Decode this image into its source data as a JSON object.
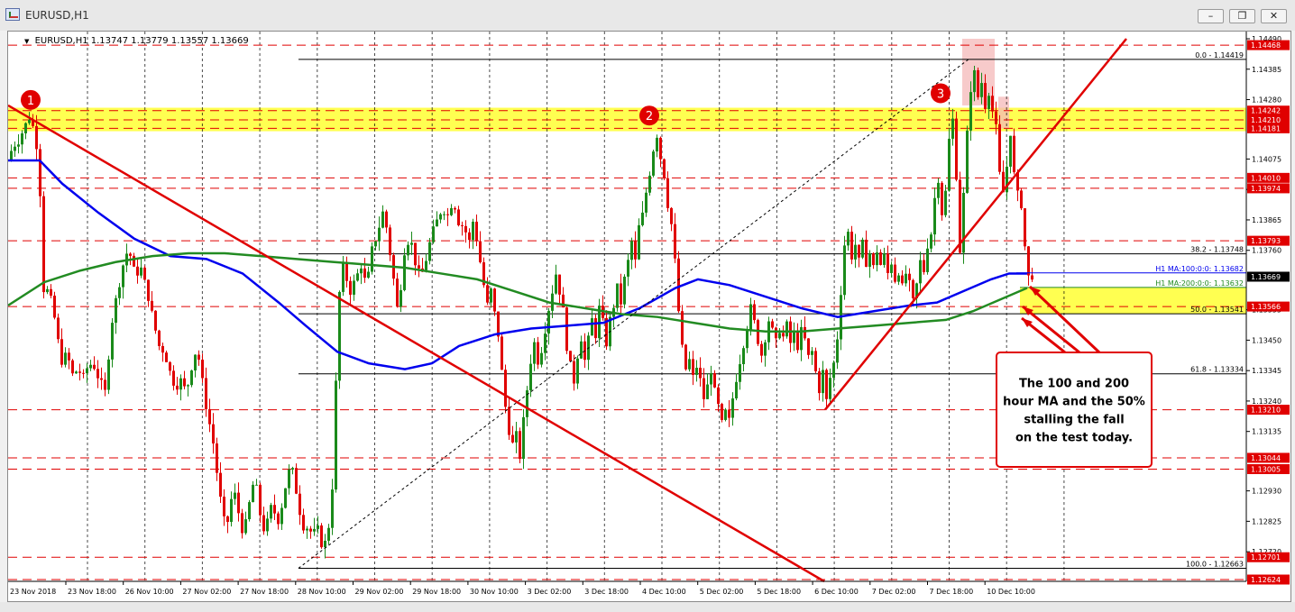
{
  "window": {
    "title": "EURUSD,H1",
    "min_glyph": "–",
    "max_glyph": "❐",
    "close_glyph": "✕"
  },
  "chart_info": {
    "arrow": "▼",
    "header": "EURUSD,H1  1.13747 1.13779 1.13557 1.13669"
  },
  "chart_data": {
    "type": "candlestick",
    "symbol": "EURUSD",
    "timeframe": "H1",
    "last_bar": {
      "open": 1.13747,
      "high": 1.13779,
      "low": 1.13557,
      "close": 1.13669
    },
    "y_range": [
      1.12624,
      1.1449
    ],
    "y_ticks": [
      1.1449,
      1.14385,
      1.1428,
      1.14075,
      1.1397,
      1.13865,
      1.1376,
      1.13555,
      1.1345,
      1.13345,
      1.1324,
      1.13135,
      1.1293,
      1.12825,
      1.1272
    ],
    "x_labels": [
      "23 Nov 2018",
      "23 Nov 18:00",
      "26 Nov 10:00",
      "27 Nov 02:00",
      "27 Nov 18:00",
      "28 Nov 10:00",
      "29 Nov 02:00",
      "29 Nov 18:00",
      "30 Nov 10:00",
      "3 Dec 02:00",
      "3 Dec 18:00",
      "4 Dec 10:00",
      "5 Dec 02:00",
      "5 Dec 18:00",
      "6 Dec 10:00",
      "7 Dec 02:00",
      "7 Dec 18:00",
      "10 Dec 10:00"
    ],
    "price_path": [
      [
        0,
        1.1407
      ],
      [
        6,
        1.1412
      ],
      [
        12,
        1.1414
      ],
      [
        18,
        1.1418
      ],
      [
        24,
        1.1422
      ],
      [
        30,
        1.1417
      ],
      [
        34,
        1.1408
      ],
      [
        38,
        1.1384
      ],
      [
        41,
        1.1352
      ],
      [
        44,
        1.1362
      ],
      [
        50,
        1.1357
      ],
      [
        55,
        1.1346
      ],
      [
        60,
        1.1338
      ],
      [
        66,
        1.134
      ],
      [
        72,
        1.1333
      ],
      [
        78,
        1.1335
      ],
      [
        84,
        1.1332
      ],
      [
        90,
        1.1337
      ],
      [
        96,
        1.1336
      ],
      [
        102,
        1.1331
      ],
      [
        108,
        1.1327
      ],
      [
        112,
        1.134
      ],
      [
        116,
        1.1352
      ],
      [
        122,
        1.1362
      ],
      [
        128,
        1.1371
      ],
      [
        133,
        1.1376
      ],
      [
        138,
        1.1373
      ],
      [
        142,
        1.1365
      ],
      [
        146,
        1.1372
      ],
      [
        150,
        1.1367
      ],
      [
        156,
        1.136
      ],
      [
        162,
        1.1351
      ],
      [
        168,
        1.1343
      ],
      [
        174,
        1.1341
      ],
      [
        180,
        1.1334
      ],
      [
        186,
        1.1329
      ],
      [
        192,
        1.1331
      ],
      [
        198,
        1.1327
      ],
      [
        204,
        1.1336
      ],
      [
        210,
        1.1343
      ],
      [
        214,
        1.1334
      ],
      [
        218,
        1.1327
      ],
      [
        222,
        1.1318
      ],
      [
        226,
        1.1314
      ],
      [
        230,
        1.1305
      ],
      [
        234,
        1.1294
      ],
      [
        238,
        1.1286
      ],
      [
        242,
        1.1279
      ],
      [
        246,
        1.1286
      ],
      [
        250,
        1.1294
      ],
      [
        254,
        1.1289
      ],
      [
        258,
        1.1282
      ],
      [
        262,
        1.1278
      ],
      [
        266,
        1.1285
      ],
      [
        270,
        1.1292
      ],
      [
        274,
        1.1298
      ],
      [
        278,
        1.1289
      ],
      [
        282,
        1.1281
      ],
      [
        286,
        1.1279
      ],
      [
        290,
        1.1285
      ],
      [
        294,
        1.1289
      ],
      [
        298,
        1.1282
      ],
      [
        302,
        1.1284
      ],
      [
        306,
        1.1292
      ],
      [
        310,
        1.1297
      ],
      [
        314,
        1.1302
      ],
      [
        318,
        1.1297
      ],
      [
        322,
        1.1289
      ],
      [
        326,
        1.1283
      ],
      [
        330,
        1.1279
      ],
      [
        334,
        1.1282
      ],
      [
        338,
        1.1276
      ],
      [
        342,
        1.1281
      ],
      [
        346,
        1.1278
      ],
      [
        350,
        1.1272
      ],
      [
        354,
        1.1278
      ],
      [
        358,
        1.1284
      ],
      [
        361,
        1.13
      ],
      [
        364,
        1.133
      ],
      [
        367,
        1.1356
      ],
      [
        370,
        1.1372
      ],
      [
        374,
        1.1368
      ],
      [
        380,
        1.1362
      ],
      [
        386,
        1.1366
      ],
      [
        392,
        1.1371
      ],
      [
        398,
        1.1363
      ],
      [
        404,
        1.1376
      ],
      [
        410,
        1.1382
      ],
      [
        416,
        1.1389
      ],
      [
        420,
        1.1384
      ],
      [
        424,
        1.1375
      ],
      [
        428,
        1.1366
      ],
      [
        432,
        1.1356
      ],
      [
        436,
        1.1364
      ],
      [
        440,
        1.1376
      ],
      [
        446,
        1.1381
      ],
      [
        452,
        1.1372
      ],
      [
        458,
        1.1366
      ],
      [
        464,
        1.1373
      ],
      [
        470,
        1.1381
      ],
      [
        476,
        1.1386
      ],
      [
        482,
        1.1391
      ],
      [
        488,
        1.1388
      ],
      [
        494,
        1.1394
      ],
      [
        500,
        1.1386
      ],
      [
        506,
        1.1384
      ],
      [
        512,
        1.1379
      ],
      [
        516,
        1.1386
      ],
      [
        520,
        1.138
      ],
      [
        524,
        1.1372
      ],
      [
        528,
        1.1364
      ],
      [
        532,
        1.1357
      ],
      [
        536,
        1.1362
      ],
      [
        540,
        1.1354
      ],
      [
        544,
        1.1347
      ],
      [
        548,
        1.1334
      ],
      [
        552,
        1.1322
      ],
      [
        556,
        1.1314
      ],
      [
        560,
        1.1309
      ],
      [
        564,
        1.1312
      ],
      [
        568,
        1.1305
      ],
      [
        572,
        1.1317
      ],
      [
        576,
        1.1328
      ],
      [
        580,
        1.1338
      ],
      [
        584,
        1.1344
      ],
      [
        588,
        1.1338
      ],
      [
        592,
        1.1342
      ],
      [
        596,
        1.1349
      ],
      [
        600,
        1.1356
      ],
      [
        604,
        1.1362
      ],
      [
        608,
        1.1368
      ],
      [
        612,
        1.1362
      ],
      [
        616,
        1.1355
      ],
      [
        620,
        1.1343
      ],
      [
        624,
        1.1336
      ],
      [
        628,
        1.1331
      ],
      [
        632,
        1.134
      ],
      [
        636,
        1.1346
      ],
      [
        640,
        1.1338
      ],
      [
        644,
        1.1345
      ],
      [
        648,
        1.1352
      ],
      [
        652,
        1.1347
      ],
      [
        656,
        1.1356
      ],
      [
        660,
        1.1351
      ],
      [
        664,
        1.1344
      ],
      [
        668,
        1.1352
      ],
      [
        672,
        1.1357
      ],
      [
        676,
        1.1363
      ],
      [
        680,
        1.1358
      ],
      [
        684,
        1.1366
      ],
      [
        688,
        1.1372
      ],
      [
        692,
        1.1379
      ],
      [
        696,
        1.1372
      ],
      [
        700,
        1.1384
      ],
      [
        704,
        1.1388
      ],
      [
        708,
        1.1396
      ],
      [
        712,
        1.1403
      ],
      [
        716,
        1.1411
      ],
      [
        720,
        1.1416
      ],
      [
        724,
        1.1408
      ],
      [
        728,
        1.1402
      ],
      [
        732,
        1.1392
      ],
      [
        736,
        1.1385
      ],
      [
        740,
        1.1372
      ],
      [
        744,
        1.1355
      ],
      [
        748,
        1.1342
      ],
      [
        752,
        1.1335
      ],
      [
        756,
        1.1338
      ],
      [
        760,
        1.1332
      ],
      [
        764,
        1.1336
      ],
      [
        768,
        1.1331
      ],
      [
        772,
        1.1325
      ],
      [
        776,
        1.1329
      ],
      [
        780,
        1.1335
      ],
      [
        784,
        1.1327
      ],
      [
        788,
        1.1322
      ],
      [
        792,
        1.1316
      ],
      [
        796,
        1.132
      ],
      [
        800,
        1.1317
      ],
      [
        804,
        1.1325
      ],
      [
        808,
        1.1332
      ],
      [
        812,
        1.1338
      ],
      [
        816,
        1.1344
      ],
      [
        820,
        1.135
      ],
      [
        824,
        1.1356
      ],
      [
        828,
        1.1351
      ],
      [
        832,
        1.1345
      ],
      [
        836,
        1.134
      ],
      [
        840,
        1.1346
      ],
      [
        844,
        1.1352
      ],
      [
        848,
        1.1348
      ],
      [
        852,
        1.1344
      ],
      [
        856,
        1.1349
      ],
      [
        860,
        1.1346
      ],
      [
        864,
        1.135
      ],
      [
        868,
        1.1344
      ],
      [
        872,
        1.1347
      ],
      [
        876,
        1.1343
      ],
      [
        880,
        1.1348
      ],
      [
        884,
        1.1345
      ],
      [
        888,
        1.1339
      ],
      [
        892,
        1.1341
      ],
      [
        896,
        1.1334
      ],
      [
        900,
        1.1328
      ],
      [
        904,
        1.1334
      ],
      [
        908,
        1.1324
      ],
      [
        912,
        1.1332
      ],
      [
        916,
        1.1337
      ],
      [
        920,
        1.1346
      ],
      [
        924,
        1.1362
      ],
      [
        928,
        1.1378
      ],
      [
        932,
        1.1382
      ],
      [
        936,
        1.1374
      ],
      [
        940,
        1.1378
      ],
      [
        944,
        1.1372
      ],
      [
        948,
        1.1378
      ],
      [
        952,
        1.1372
      ],
      [
        956,
        1.1375
      ],
      [
        960,
        1.137
      ],
      [
        964,
        1.1376
      ],
      [
        968,
        1.1371
      ],
      [
        972,
        1.1374
      ],
      [
        976,
        1.1368
      ],
      [
        980,
        1.1372
      ],
      [
        984,
        1.1366
      ],
      [
        988,
        1.1369
      ],
      [
        992,
        1.1363
      ],
      [
        996,
        1.1368
      ],
      [
        1000,
        1.1364
      ],
      [
        1004,
        1.1358
      ],
      [
        1008,
        1.1364
      ],
      [
        1012,
        1.1372
      ],
      [
        1016,
        1.1369
      ],
      [
        1020,
        1.1378
      ],
      [
        1024,
        1.1382
      ],
      [
        1028,
        1.1394
      ],
      [
        1032,
        1.1401
      ],
      [
        1036,
        1.1389
      ],
      [
        1040,
        1.1396
      ],
      [
        1044,
        1.1414
      ],
      [
        1048,
        1.1421
      ],
      [
        1052,
        1.1402
      ],
      [
        1056,
        1.1376
      ],
      [
        1060,
        1.1395
      ],
      [
        1064,
        1.1416
      ],
      [
        1068,
        1.1432
      ],
      [
        1072,
        1.1437
      ],
      [
        1076,
        1.1429
      ],
      [
        1080,
        1.1434
      ],
      [
        1084,
        1.1426
      ],
      [
        1088,
        1.1431
      ],
      [
        1092,
        1.1424
      ],
      [
        1096,
        1.1418
      ],
      [
        1100,
        1.1402
      ],
      [
        1104,
        1.1396
      ],
      [
        1108,
        1.1405
      ],
      [
        1112,
        1.1417
      ],
      [
        1116,
        1.1402
      ],
      [
        1120,
        1.1395
      ],
      [
        1124,
        1.1392
      ],
      [
        1127,
        1.1382
      ],
      [
        1130,
        1.1368
      ],
      [
        1133,
        1.1366
      ],
      [
        1137,
        1.1368
      ]
    ],
    "ma_100": {
      "label": "H1 MA:100:0:0: 1.13682",
      "color": "#0000ee",
      "points": [
        [
          0,
          1.1407
        ],
        [
          35,
          1.1407
        ],
        [
          60,
          1.1399
        ],
        [
          100,
          1.1389
        ],
        [
          140,
          1.138
        ],
        [
          180,
          1.1374
        ],
        [
          220,
          1.1373
        ],
        [
          260,
          1.1368
        ],
        [
          300,
          1.1358
        ],
        [
          330,
          1.135
        ],
        [
          365,
          1.1341
        ],
        [
          400,
          1.1337
        ],
        [
          440,
          1.1335
        ],
        [
          470,
          1.1337
        ],
        [
          500,
          1.1343
        ],
        [
          540,
          1.1347
        ],
        [
          580,
          1.1349
        ],
        [
          620,
          1.135
        ],
        [
          660,
          1.1351
        ],
        [
          700,
          1.1356
        ],
        [
          740,
          1.1363
        ],
        [
          765,
          1.1366
        ],
        [
          800,
          1.1364
        ],
        [
          840,
          1.136
        ],
        [
          880,
          1.1356
        ],
        [
          920,
          1.1353
        ],
        [
          960,
          1.1355
        ],
        [
          1000,
          1.1357
        ],
        [
          1030,
          1.1358
        ],
        [
          1060,
          1.1362
        ],
        [
          1090,
          1.1366
        ],
        [
          1110,
          1.1368
        ],
        [
          1130,
          1.1368
        ]
      ]
    },
    "ma_200": {
      "label": "H1 MA:200:0:0: 1.13632",
      "color": "#228b22",
      "points": [
        [
          0,
          1.1357
        ],
        [
          40,
          1.1365
        ],
        [
          80,
          1.1369
        ],
        [
          120,
          1.1372
        ],
        [
          160,
          1.1374
        ],
        [
          200,
          1.1375
        ],
        [
          240,
          1.1375
        ],
        [
          280,
          1.1374
        ],
        [
          320,
          1.1373
        ],
        [
          360,
          1.1372
        ],
        [
          400,
          1.1371
        ],
        [
          440,
          1.137
        ],
        [
          480,
          1.1368
        ],
        [
          520,
          1.1366
        ],
        [
          560,
          1.1362
        ],
        [
          600,
          1.1358
        ],
        [
          640,
          1.1356
        ],
        [
          680,
          1.1354
        ],
        [
          720,
          1.1353
        ],
        [
          760,
          1.1351
        ],
        [
          800,
          1.1349
        ],
        [
          840,
          1.1348
        ],
        [
          880,
          1.1348
        ],
        [
          920,
          1.1349
        ],
        [
          960,
          1.135
        ],
        [
          1000,
          1.1351
        ],
        [
          1040,
          1.1352
        ],
        [
          1070,
          1.1355
        ],
        [
          1100,
          1.1359
        ],
        [
          1130,
          1.1363
        ]
      ]
    },
    "h_lines": [
      {
        "price": 1.14468,
        "style": "dash",
        "label": "1.14468"
      },
      {
        "price": 1.14419,
        "style": "solid-black",
        "label": "0.0 - 1.14419"
      },
      {
        "price": 1.14242,
        "style": "dash",
        "label": "1.14242"
      },
      {
        "price": 1.1421,
        "style": "dash",
        "label": "1.14210"
      },
      {
        "price": 1.14181,
        "style": "dash",
        "label": "1.14181"
      },
      {
        "price": 1.1401,
        "style": "dash",
        "label": "1.14010"
      },
      {
        "price": 1.13974,
        "style": "dash",
        "label": "1.13974"
      },
      {
        "price": 1.13793,
        "style": "dash",
        "label": "1.13793"
      },
      {
        "price": 1.13748,
        "style": "solid-black",
        "label": "38.2 - 1.13748"
      },
      {
        "price": 1.13566,
        "style": "dash",
        "label": "1.13566"
      },
      {
        "price": 1.13541,
        "style": "solid-black",
        "label": "50.0 - 1.13541"
      },
      {
        "price": 1.13334,
        "style": "solid-black",
        "label": "61.8 - 1.13334"
      },
      {
        "price": 1.1321,
        "style": "dash",
        "label": "1.13210"
      },
      {
        "price": 1.13044,
        "style": "dash",
        "label": "1.13044"
      },
      {
        "price": 1.13005,
        "style": "dash",
        "label": "1.13005"
      },
      {
        "price": 1.12701,
        "style": "dash",
        "label": "1.12701"
      },
      {
        "price": 1.12663,
        "style": "solid-black",
        "label": "100.0 - 1.12663"
      },
      {
        "price": 1.12624,
        "style": "dash",
        "label": "1.12624"
      }
    ],
    "current_price_label": "1.13669",
    "markers": [
      "1",
      "2",
      "3"
    ],
    "annotation": "The 100 and 200 hour MA and the 50% stalling the fall on the test today.",
    "colors": {
      "bull": "#1a8a1a",
      "bear": "#e00000",
      "zone": "#ffff33",
      "trendline": "#e00000",
      "marker": "#e00000",
      "price_tag": "#e00000"
    }
  }
}
